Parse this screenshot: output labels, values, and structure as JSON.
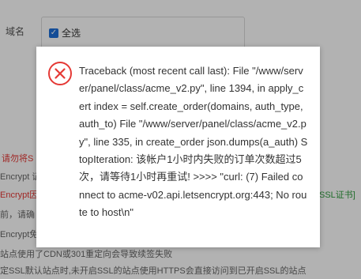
{
  "form": {
    "domain_label": "域名",
    "select_all_label": "全选"
  },
  "background_text": {
    "line1": "请勿将S",
    "line2": "Encrypt 证",
    "line3": "Encrypt因",
    "line3_right": "SSL证书]",
    "line4": "前，请确",
    "line5": "Encrypt免",
    "line6": "站点使用了CDN或301重定向会导致续签失败",
    "line7": "定SSL默认站点时,未开启SSL的站点使用HTTPS会直接访问到已开启SSL的站点"
  },
  "dialog": {
    "icon": "error-circle-x-icon",
    "message": "Traceback (most recent call last): File \"/www/server/panel/class/acme_v2.py\", line 1394, in apply_cert index = self.create_order(domains, auth_type, auth_to) File \"/www/server/panel/class/acme_v2.py\", line 335, in create_order json.dumps(a_auth) StopIteration: 该帐户1小时内失败的订单次数超过5次，请等待1小时再重试! >>>> \"curl: (7) Failed connect to acme-v02.api.letsencrypt.org:443; No route to host\\n\""
  },
  "colors": {
    "error_red": "#e53935",
    "checkbox_blue": "#1e6fd9",
    "link_green": "#2e9d3e"
  }
}
